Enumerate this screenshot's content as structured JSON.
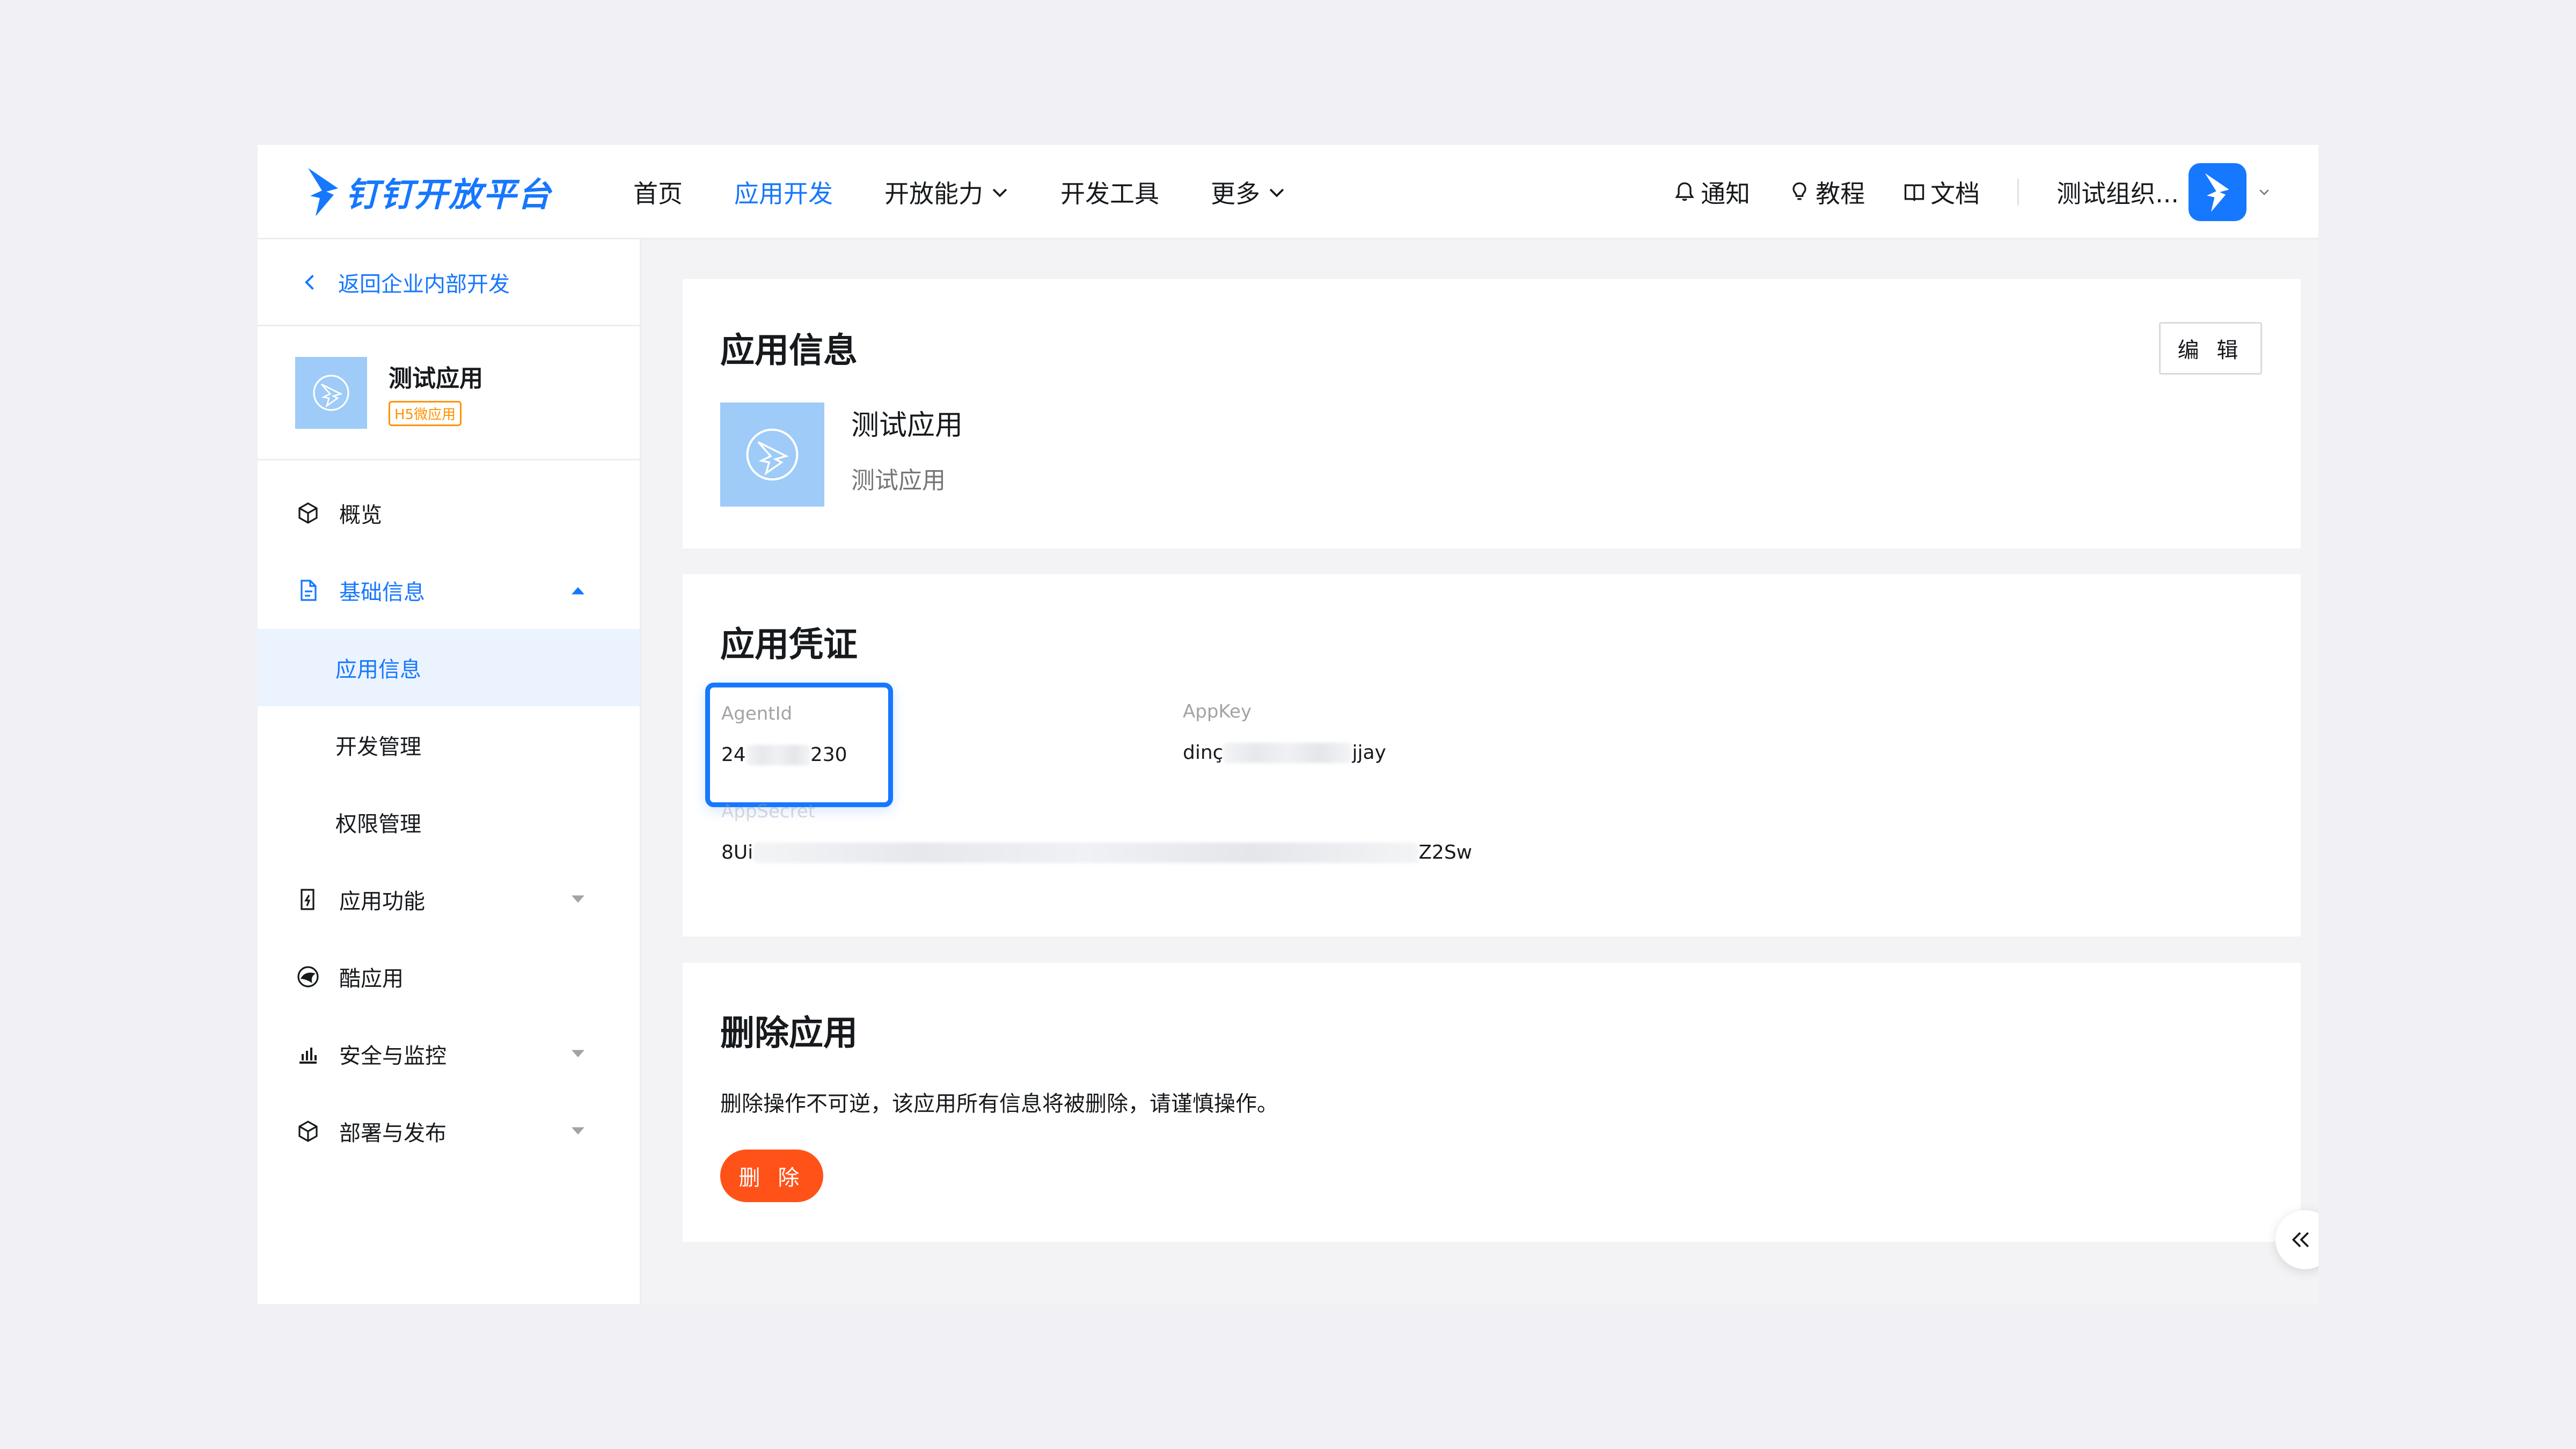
{
  "brand": {
    "name": "钉钉开放平台",
    "accent": "#1677ff"
  },
  "nav": {
    "items": [
      {
        "label": "首页",
        "active": false
      },
      {
        "label": "应用开发",
        "active": true
      },
      {
        "label": "开放能力",
        "dropdown": true
      },
      {
        "label": "开发工具"
      },
      {
        "label": "更多",
        "dropdown": true
      }
    ],
    "right": {
      "notify": "通知",
      "tutorial": "教程",
      "docs": "文档",
      "org": "测试组织..."
    }
  },
  "sidebar": {
    "back": "返回企业内部开发",
    "app": {
      "name": "测试应用",
      "badge": "H5微应用"
    },
    "menu": [
      {
        "label": "概览",
        "icon": "cube-icon"
      },
      {
        "label": "基础信息",
        "icon": "doc-icon",
        "expanded": true,
        "children": [
          {
            "label": "应用信息",
            "selected": true
          },
          {
            "label": "开发管理"
          },
          {
            "label": "权限管理"
          }
        ]
      },
      {
        "label": "应用功能",
        "icon": "phone-bolt-icon",
        "has_children": true
      },
      {
        "label": "酷应用",
        "icon": "cool-app-icon"
      },
      {
        "label": "安全与监控",
        "icon": "bar-chart-icon",
        "has_children": true
      },
      {
        "label": "部署与发布",
        "icon": "package-icon",
        "has_children": true
      }
    ]
  },
  "info_card": {
    "title": "应用信息",
    "edit": "编 辑",
    "app_name": "测试应用",
    "app_desc": "测试应用"
  },
  "cred_card": {
    "title": "应用凭证",
    "agent_id": {
      "label": "AgentId",
      "prefix": "24",
      "suffix": "230"
    },
    "app_key": {
      "label": "AppKey",
      "prefix": "dinç",
      "suffix": "jjay"
    },
    "app_secret": {
      "label": "AppSecret",
      "prefix": "8Ui",
      "suffix": "Z2Sw"
    }
  },
  "del_card": {
    "title": "删除应用",
    "desc": "删除操作不可逆，该应用所有信息将被删除，请谨慎操作。",
    "button": "删 除",
    "danger_color": "#ff5219"
  }
}
